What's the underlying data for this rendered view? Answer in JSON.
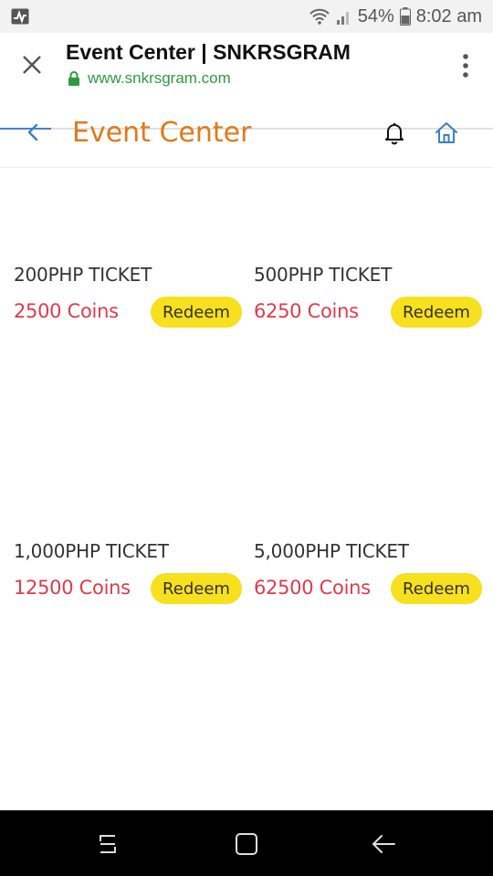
{
  "status_bar": {
    "battery_text": "54%",
    "time": "8:02 am",
    "icons": [
      "activity-icon",
      "wifi-icon",
      "signal-icon",
      "battery-icon"
    ]
  },
  "browser": {
    "title": "Event Center | SNKRSGRAM",
    "url": "www.snkrsgram.com",
    "icons": [
      "close-icon",
      "lock-icon",
      "more-vert-icon"
    ],
    "url_color": "#2e9a43"
  },
  "header": {
    "title": "Event Center",
    "title_color": "#e07a1a",
    "icons": [
      "chevron-left-icon",
      "bell-icon",
      "home-icon"
    ]
  },
  "tickets": [
    {
      "name": "200PHP TICKET",
      "coins": "2500 Coins",
      "button": "Redeem"
    },
    {
      "name": "500PHP TICKET",
      "coins": "6250 Coins",
      "button": "Redeem"
    },
    {
      "name": "1,000PHP TICKET",
      "coins": "12500 Coins",
      "button": "Redeem"
    },
    {
      "name": "5,000PHP TICKET",
      "coins": "62500 Coins",
      "button": "Redeem"
    }
  ],
  "colors": {
    "coins": "#e03b4b",
    "redeem_button": "#f7e01e"
  },
  "nav_bar": {
    "icons": [
      "recents-icon",
      "home-square-icon",
      "back-arrow-icon"
    ]
  }
}
